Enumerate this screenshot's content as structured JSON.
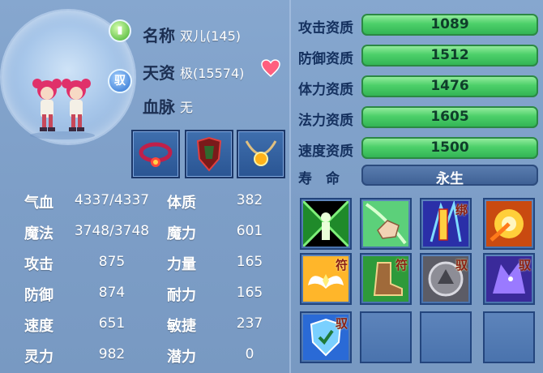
{
  "pet": {
    "name_label": "名称",
    "name_value": "双儿(145)",
    "aptitude_label": "天资",
    "aptitude_value": "极(15574)",
    "bloodline_label": "血脉",
    "bloodline_value": "无"
  },
  "stats": [
    {
      "label": "气血",
      "value": "4337/4337"
    },
    {
      "label": "魔法",
      "value": "3748/3748"
    },
    {
      "label": "攻击",
      "value": "875"
    },
    {
      "label": "防御",
      "value": "874"
    },
    {
      "label": "速度",
      "value": "651"
    },
    {
      "label": "灵力",
      "value": "982"
    }
  ],
  "attributes": [
    {
      "label": "体质",
      "value": "382"
    },
    {
      "label": "魔力",
      "value": "601"
    },
    {
      "label": "力量",
      "value": "165"
    },
    {
      "label": "耐力",
      "value": "165"
    },
    {
      "label": "敏捷",
      "value": "237"
    },
    {
      "label": "潜力",
      "value": "0"
    }
  ],
  "aptitudes": [
    {
      "label": "攻击资质",
      "value": "1089"
    },
    {
      "label": "防御资质",
      "value": "1512"
    },
    {
      "label": "体力资质",
      "value": "1476"
    },
    {
      "label": "法力资质",
      "value": "1605"
    },
    {
      "label": "速度资质",
      "value": "1500"
    }
  ],
  "life": {
    "label": "寿　命",
    "value": "永生"
  },
  "skills": [
    {
      "icon": "green-aura-skill-icon",
      "tag": ""
    },
    {
      "icon": "pointing-hand-skill-icon",
      "tag": ""
    },
    {
      "icon": "lightning-seal-skill-icon",
      "tag": "绑"
    },
    {
      "icon": "fireball-skill-icon",
      "tag": ""
    },
    {
      "icon": "wings-skill-icon",
      "tag": "符"
    },
    {
      "icon": "boot-skill-icon",
      "tag": "符"
    },
    {
      "icon": "beast-skill-icon",
      "tag": "驭"
    },
    {
      "icon": "wolf-skill-icon",
      "tag": "驭"
    },
    {
      "icon": "shield-skill-icon",
      "tag": "驭"
    },
    {
      "icon": "empty-slot",
      "tag": ""
    },
    {
      "icon": "empty-slot",
      "tag": ""
    },
    {
      "icon": "empty-slot",
      "tag": ""
    }
  ],
  "badges": {
    "green_icon": "jade-badge-icon",
    "ride_tag": "驭"
  },
  "colors": {
    "apt_bar": "#4dd06a",
    "life_bar": "#3d5f93",
    "panel_bg": "#7c9dc6"
  }
}
